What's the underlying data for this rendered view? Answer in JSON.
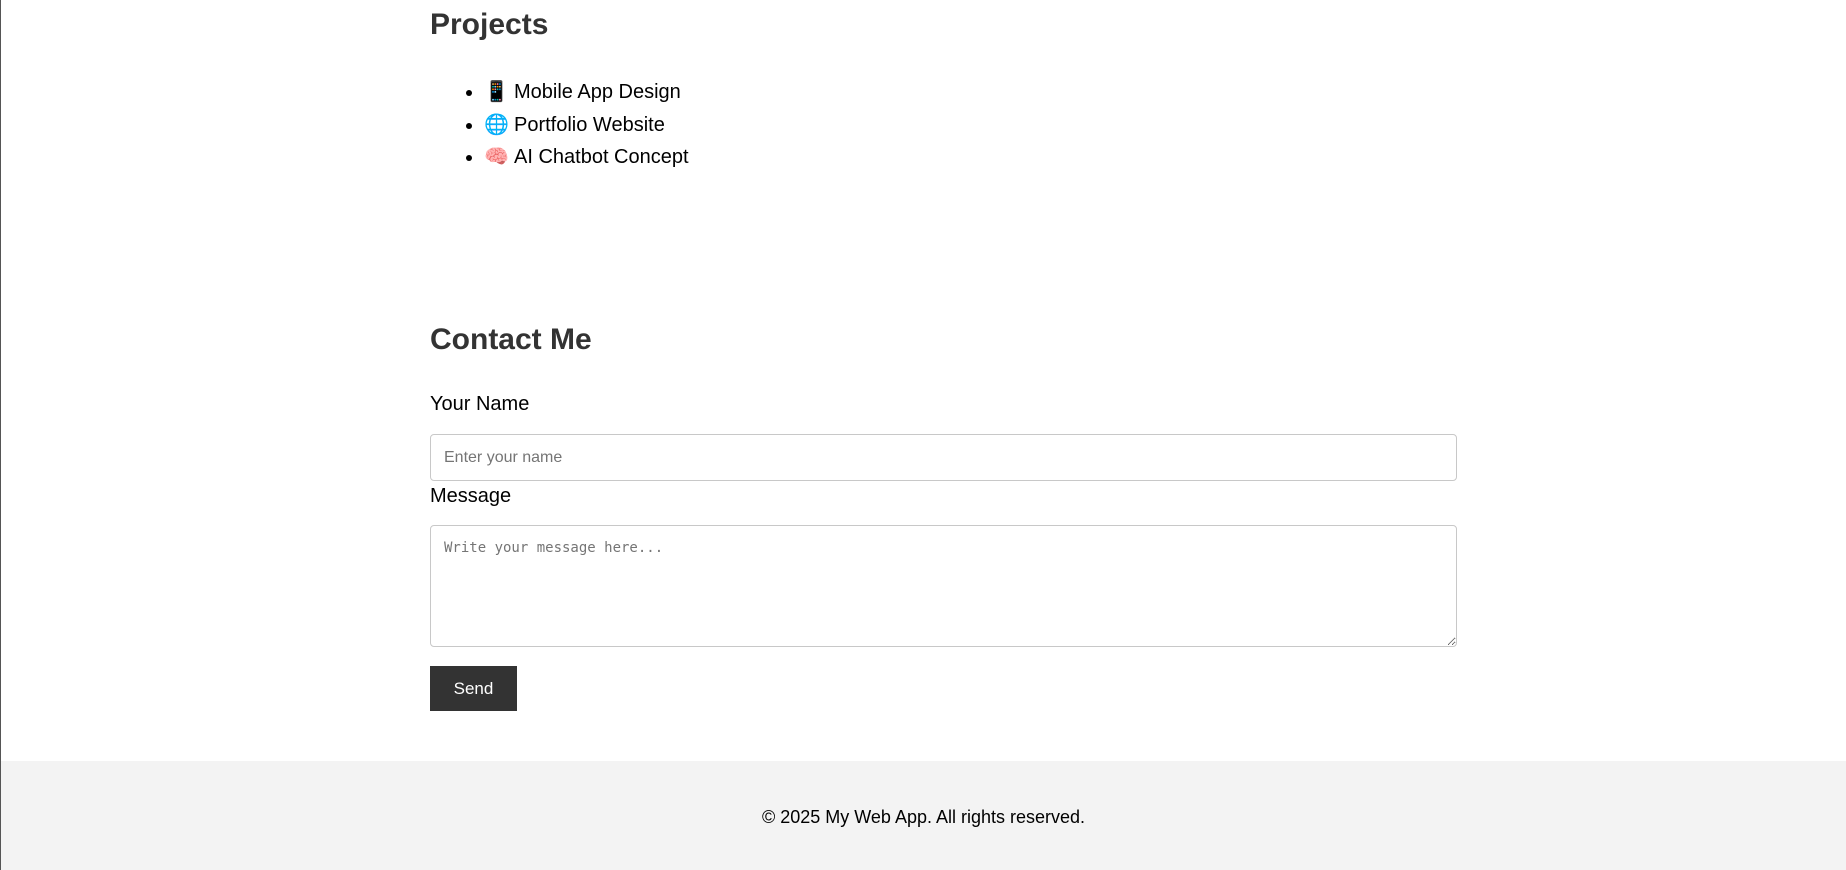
{
  "projects": {
    "title": "Projects",
    "items": [
      {
        "icon": "📱",
        "icon_name": "mobile-phone-icon",
        "label": "Mobile App Design"
      },
      {
        "icon": "🌐",
        "icon_name": "globe-icon",
        "label": "Portfolio Website"
      },
      {
        "icon": "🧠",
        "icon_name": "brain-icon",
        "label": "AI Chatbot Concept"
      }
    ]
  },
  "contact": {
    "title": "Contact Me",
    "name_label": "Your Name",
    "name_placeholder": "Enter your name",
    "name_value": "",
    "message_label": "Message",
    "message_placeholder": "Write your message here...",
    "message_value": "",
    "send_label": "Send"
  },
  "footer": {
    "text": "© 2025 My Web App. All rights reserved."
  },
  "colors": {
    "heading": "#333333",
    "button_bg": "#333333",
    "button_text": "#ffffff",
    "footer_bg": "#f3f3f3",
    "input_border": "#c8c8c8"
  }
}
